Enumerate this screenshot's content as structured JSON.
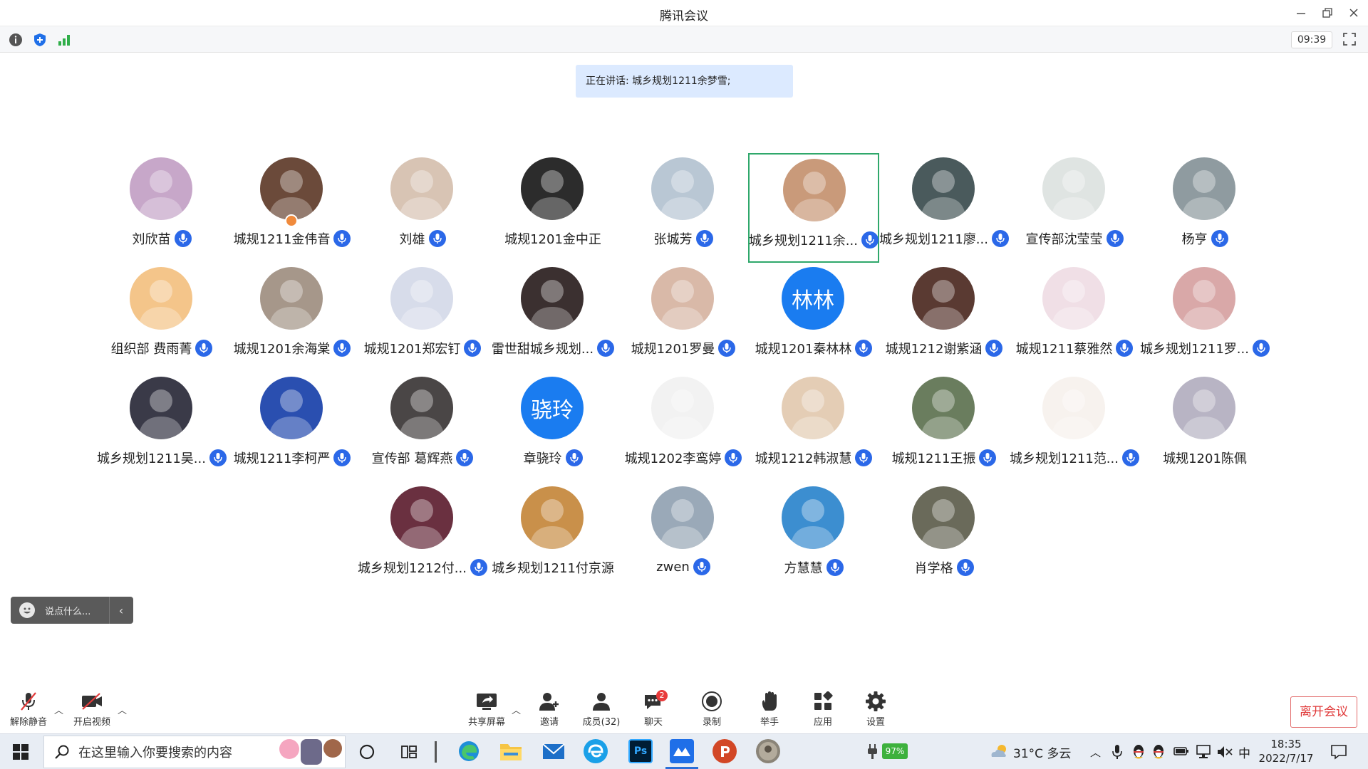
{
  "window": {
    "title": "腾讯会议"
  },
  "infobar": {
    "timer": "09:39"
  },
  "speaking": {
    "text": "正在讲话: 城乡规划1211余梦雪;"
  },
  "participants": [
    {
      "name": "刘欣苗",
      "avatar_color": "#c7a7c9",
      "mic": true
    },
    {
      "name": "城规1211金伟音",
      "avatar_color": "#6b4a3a",
      "mic": true,
      "host": true
    },
    {
      "name": "刘雄",
      "avatar_color": "#d8c4b4",
      "mic": true
    },
    {
      "name": "城规1201金中正",
      "avatar_color": "#2c2c2c",
      "mic": false
    },
    {
      "name": "张城芳",
      "avatar_color": "#b9c7d4",
      "mic": true
    },
    {
      "name": "城乡规划1211余...",
      "avatar_color": "#c99a7a",
      "mic": true,
      "active": true
    },
    {
      "name": "城乡规划1211廖...",
      "avatar_color": "#4a5a5c",
      "mic": true
    },
    {
      "name": "宣传部沈莹莹",
      "avatar_color": "#dfe4e2",
      "mic": true
    },
    {
      "name": "杨亨",
      "avatar_color": "#8f9ba0",
      "mic": true
    },
    {
      "name": "组织部 费雨菁",
      "avatar_color": "#f4c58a",
      "mic": true
    },
    {
      "name": "城规1201余海棠",
      "avatar_color": "#a6978a",
      "mic": true
    },
    {
      "name": "城规1201郑宏钉",
      "avatar_color": "#d7dcea",
      "mic": true
    },
    {
      "name": "雷世甜城乡规划...",
      "avatar_color": "#3b3030",
      "mic": true
    },
    {
      "name": "城规1201罗曼",
      "avatar_color": "#d9b9a8",
      "mic": true
    },
    {
      "name": "城规1201秦林林",
      "avatar_text": "林林",
      "mic": true
    },
    {
      "name": "城规1212谢紫涵",
      "avatar_color": "#5a3a32",
      "mic": true
    },
    {
      "name": "城规1211蔡雅然",
      "avatar_color": "#f0dfe6",
      "mic": true
    },
    {
      "name": "城乡规划1211罗...",
      "avatar_color": "#d9a8a8",
      "mic": true
    },
    {
      "name": "城乡规划1211吴...",
      "avatar_color": "#3a3a48",
      "mic": true
    },
    {
      "name": "城规1211李柯严",
      "avatar_color": "#2a4fb0",
      "mic": true
    },
    {
      "name": "宣传部 葛辉燕",
      "avatar_color": "#4a4646",
      "mic": true
    },
    {
      "name": "章骁玲",
      "avatar_text": "骁玲",
      "mic": true
    },
    {
      "name": "城规1202李鸾婷",
      "avatar_color": "#f2f2f2",
      "mic": true
    },
    {
      "name": "城规1212韩淑慧",
      "avatar_color": "#e4cdb5",
      "mic": true
    },
    {
      "name": "城规1211王振",
      "avatar_color": "#6a7d5e",
      "mic": true
    },
    {
      "name": "城乡规划1211范...",
      "avatar_color": "#f7f2ee",
      "mic": true
    },
    {
      "name": "城规1201陈佩",
      "avatar_color": "#b8b4c4",
      "mic": false
    },
    {
      "name": "城乡规划1212付...",
      "avatar_color": "#6a3040",
      "mic": true
    },
    {
      "name": "城乡规划1211付京源",
      "avatar_color": "#c9904a",
      "mic": false
    },
    {
      "name": "zwen",
      "avatar_color": "#9aa9b8",
      "mic": true
    },
    {
      "name": "方慧慧",
      "avatar_color": "#3c8ed0",
      "mic": true
    },
    {
      "name": "肖学格",
      "avatar_color": "#6a6a5a",
      "mic": true
    }
  ],
  "chat": {
    "placeholder": "说点什么..."
  },
  "toolbar": {
    "unmute": "解除静音",
    "video": "开启视频",
    "share": "共享屏幕",
    "invite": "邀请",
    "members": "成员(32)",
    "chat": "聊天",
    "chat_badge": "2",
    "record": "录制",
    "raise_hand": "举手",
    "apps": "应用",
    "settings": "设置",
    "leave": "离开会议"
  },
  "taskbar": {
    "search_placeholder": "在这里输入你要搜索的内容",
    "ps_label": "Ps",
    "battery": "97%",
    "weather": "31°C 多云",
    "ime": "中",
    "time": "18:35",
    "date": "2022/7/17"
  }
}
